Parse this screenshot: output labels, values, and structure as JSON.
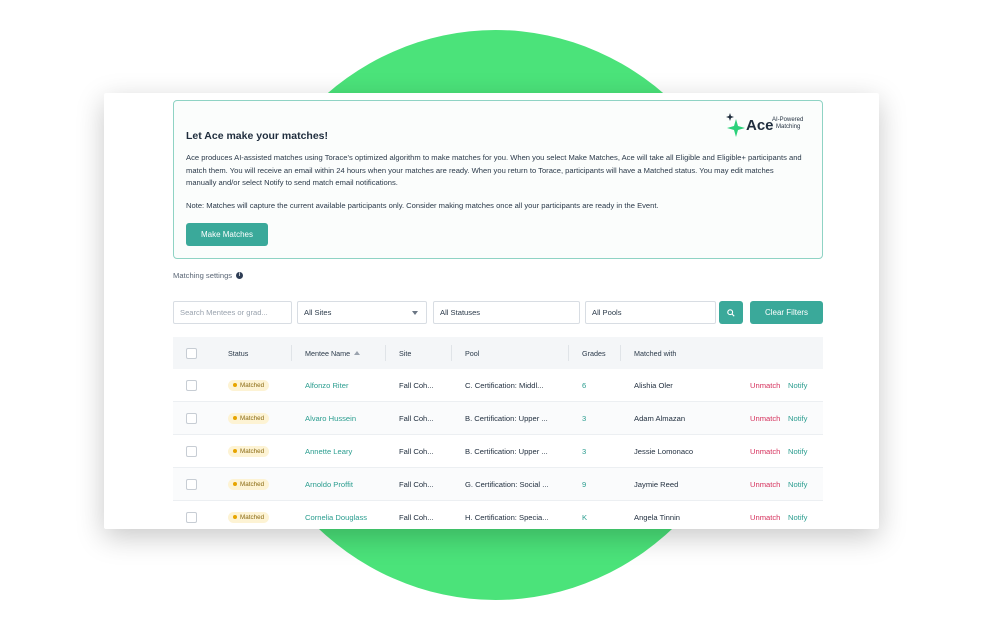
{
  "promo": {
    "title": "Let Ace make your matches!",
    "body": "Ace produces AI-assisted matches using Torace's optimized algorithm to make matches for you. When you select Make Matches, Ace will take all Eligible and Eligible+ participants and match them. You will receive an email within 24 hours when your matches are ready. When you return to Torace, participants will have a Matched status. You may edit matches manually and/or select Notify to send match email notifications.",
    "note": "Note: Matches will capture the current available participants only. Consider making matches once all your participants are ready in the Event.",
    "button": "Make Matches",
    "logo_word": "Ace",
    "logo_tag_line1": "AI-Powered",
    "logo_tag_line2": "Matching"
  },
  "settings_label": "Matching settings",
  "filters": {
    "search_placeholder": "Search Mentees or grad...",
    "sites": "All Sites",
    "statuses": "All Statuses",
    "pools": "All Pools",
    "clear": "Clear Filters"
  },
  "table": {
    "headers": {
      "status": "Status",
      "mentee": "Mentee Name",
      "site": "Site",
      "pool": "Pool",
      "grades": "Grades",
      "matched_with": "Matched with"
    },
    "rows": [
      {
        "status": "Matched",
        "mentee": "Alfonzo Riter",
        "site": "Fall Coh...",
        "pool": "C. Certification: Middl...",
        "grades": "6",
        "matched_with": "Alishia Oler",
        "unmatch": "Unmatch",
        "notify": "Notify"
      },
      {
        "status": "Matched",
        "mentee": "Alvaro Hussein",
        "site": "Fall Coh...",
        "pool": "B. Certification: Upper ...",
        "grades": "3",
        "matched_with": "Adam Almazan",
        "unmatch": "Unmatch",
        "notify": "Notify"
      },
      {
        "status": "Matched",
        "mentee": "Annette Leary",
        "site": "Fall Coh...",
        "pool": "B. Certification: Upper ...",
        "grades": "3",
        "matched_with": "Jessie Lomonaco",
        "unmatch": "Unmatch",
        "notify": "Notify"
      },
      {
        "status": "Matched",
        "mentee": "Arnoldo Proffit",
        "site": "Fall Coh...",
        "pool": "G. Certification: Social ...",
        "grades": "9",
        "matched_with": "Jaymie Reed",
        "unmatch": "Unmatch",
        "notify": "Notify"
      },
      {
        "status": "Matched",
        "mentee": "Cornelia Douglass",
        "site": "Fall Coh...",
        "pool": "H. Certification: Specia...",
        "grades": "K",
        "matched_with": "Angela Tinnin",
        "unmatch": "Unmatch",
        "notify": "Notify"
      }
    ]
  },
  "colors": {
    "accent": "#3aa99a",
    "background_circle": "#4be37a",
    "unmatch": "#d6335e",
    "matched_badge": "#fdf3d4"
  }
}
